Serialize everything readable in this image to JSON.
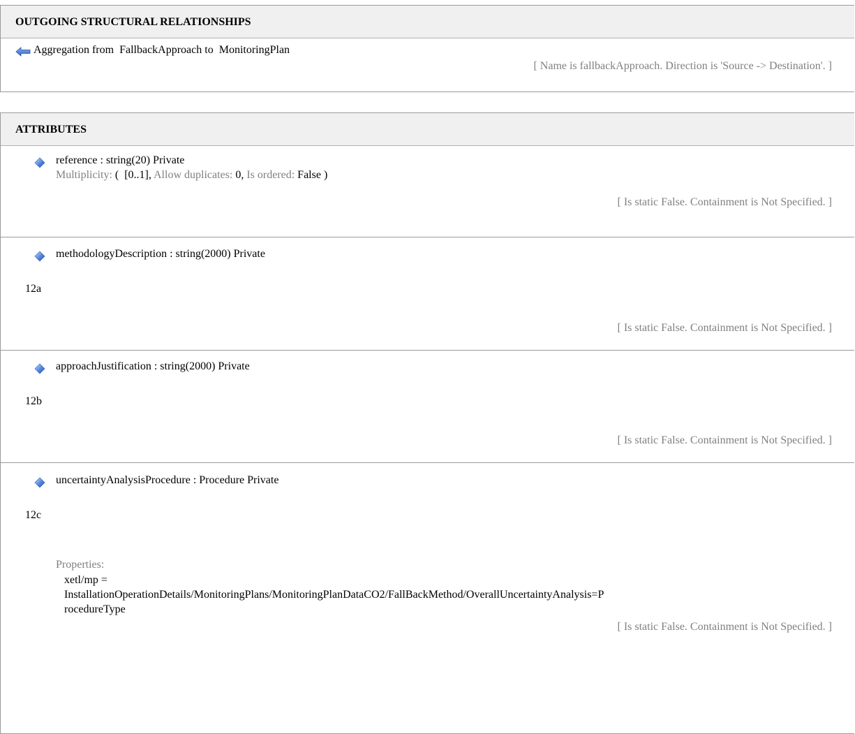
{
  "outgoing": {
    "header": "OUTGOING STRUCTURAL RELATIONSHIPS",
    "relationship": {
      "kind_prefix": "Aggregation from",
      "source": "FallbackApproach",
      "connector": "to",
      "target": "MonitoringPlan",
      "meta": "[ Name is fallbackApproach.  Direction is 'Source -> Destination'. ]"
    }
  },
  "attributes": {
    "header": "ATTRIBUTES",
    "items": [
      {
        "title": "reference : string(20)  Private",
        "multiplicity": {
          "label": "Multiplicity:",
          "open": "(",
          "range": "[0..1],",
          "dup_label": "Allow duplicates:",
          "dup_value": "0,",
          "ord_label": "Is ordered:",
          "ord_value": "False )"
        },
        "meta": "[ Is static False. Containment is Not Specified. ]"
      },
      {
        "title": "methodologyDescription : string(2000)  Private",
        "note": "12a",
        "meta": "[ Is static False. Containment is Not Specified. ]"
      },
      {
        "title": "approachJustification : string(2000)  Private",
        "note": "12b",
        "meta": "[ Is static False. Containment is Not Specified. ]"
      },
      {
        "title": "uncertaintyAnalysisProcedure : Procedure  Private",
        "note": "12c",
        "properties_label": "Properties:",
        "properties_lines": [
          "xetl/mp =",
          "InstallationOperationDetails/MonitoringPlans/MonitoringPlanDataCO2/FallBackMethod/OverallUncertaintyAnalysis=P",
          "rocedureType"
        ],
        "meta": "[ Is static False. Containment is Not Specified. ]"
      }
    ]
  },
  "icons": {
    "relationship": "aggregation-arrow-icon",
    "attribute": "attribute-diamond-icon"
  },
  "colors": {
    "header_bg": "#f0f0f0",
    "meta_text": "#808080",
    "icon_blue": "#3d6fd1"
  }
}
